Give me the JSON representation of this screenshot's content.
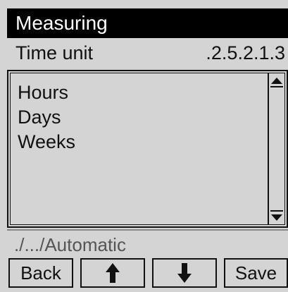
{
  "header": {
    "title": "Measuring"
  },
  "parameter": {
    "label": "Time unit",
    "code": ".2.5.2.1.3"
  },
  "list": {
    "items": [
      {
        "label": "Hours"
      },
      {
        "label": "Days"
      },
      {
        "label": "Weeks"
      }
    ]
  },
  "path": {
    "text": "./.../Automatic"
  },
  "softkeys": {
    "back_label": "Back",
    "up_icon": "arrow-up-icon",
    "down_icon": "arrow-down-icon",
    "save_label": "Save"
  },
  "colors": {
    "background": "#d4d4d4",
    "title_bar": "#000000",
    "title_text": "#ffffff",
    "path_text": "#555555"
  }
}
